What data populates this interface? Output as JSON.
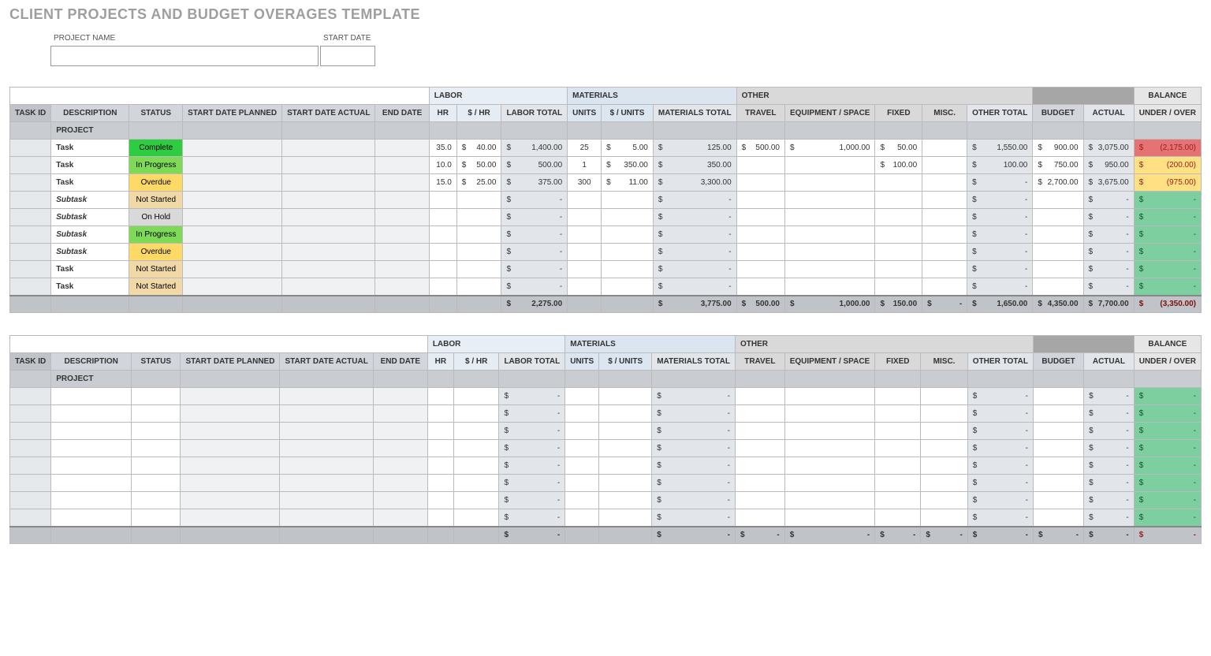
{
  "page": {
    "title": "CLIENT PROJECTS AND BUDGET OVERAGES TEMPLATE",
    "fields": {
      "project_name_label": "PROJECT NAME",
      "start_date_label": "START DATE",
      "project_name_value": "",
      "start_date_value": ""
    }
  },
  "sections": {
    "labor": "LABOR",
    "materials": "MATERIALS",
    "other": "OTHER",
    "balance": "BALANCE"
  },
  "columns": {
    "task_id": "TASK ID",
    "description": "DESCRIPTION",
    "status": "STATUS",
    "start_planned": "START DATE PLANNED",
    "start_actual": "START DATE ACTUAL",
    "end_date": "END DATE",
    "hr": "HR",
    "rate": "$ / HR",
    "labor_total": "LABOR TOTAL",
    "units": "UNITS",
    "per_units": "$ / UNITS",
    "materials_total": "MATERIALS TOTAL",
    "travel": "TRAVEL",
    "equipment": "EQUIPMENT / SPACE",
    "fixed": "FIXED",
    "misc": "MISC.",
    "other_total": "OTHER TOTAL",
    "budget": "BUDGET",
    "actual": "ACTUAL",
    "under_over": "UNDER / OVER"
  },
  "status_labels": {
    "complete": "Complete",
    "in_progress": "In Progress",
    "overdue": "Overdue",
    "not_started": "Not Started",
    "on_hold": "On Hold"
  },
  "row_labels": {
    "project": "PROJECT",
    "task": "Task",
    "subtask": "Subtask"
  },
  "block1": {
    "rows": [
      {
        "desc": "Task",
        "status": "complete",
        "hr": "35.0",
        "rate": "40.00",
        "labor_total": "1,400.00",
        "units": "25",
        "per_units": "5.00",
        "materials_total": "125.00",
        "travel": "500.00",
        "equipment": "1,000.00",
        "fixed": "50.00",
        "misc": "",
        "other_total": "1,550.00",
        "budget": "900.00",
        "actual": "3,075.00",
        "balance": "(2,175.00)",
        "bal_class": "bal-neg-hi"
      },
      {
        "desc": "Task",
        "status": "in_progress",
        "hr": "10.0",
        "rate": "50.00",
        "labor_total": "500.00",
        "units": "1",
        "per_units": "350.00",
        "materials_total": "350.00",
        "travel": "",
        "equipment": "",
        "fixed": "100.00",
        "misc": "",
        "other_total": "100.00",
        "budget": "750.00",
        "actual": "950.00",
        "balance": "(200.00)",
        "bal_class": "bal-neg"
      },
      {
        "desc": "Task",
        "status": "overdue",
        "hr": "15.0",
        "rate": "25.00",
        "labor_total": "375.00",
        "units": "300",
        "per_units": "11.00",
        "materials_total": "3,300.00",
        "travel": "",
        "equipment": "",
        "fixed": "",
        "misc": "",
        "other_total": "-",
        "budget": "2,700.00",
        "actual": "3,675.00",
        "balance": "(975.00)",
        "bal_class": "bal-neg"
      },
      {
        "desc": "Subtask",
        "status": "not_started",
        "labor_total": "-",
        "materials_total": "-",
        "other_total": "-",
        "actual": "-",
        "balance": "-",
        "bal_class": "bal-zero"
      },
      {
        "desc": "Subtask",
        "status": "on_hold",
        "labor_total": "-",
        "materials_total": "-",
        "other_total": "-",
        "actual": "-",
        "balance": "-",
        "bal_class": "bal-zero"
      },
      {
        "desc": "Subtask",
        "status": "in_progress",
        "labor_total": "-",
        "materials_total": "-",
        "other_total": "-",
        "actual": "-",
        "balance": "-",
        "bal_class": "bal-zero"
      },
      {
        "desc": "Subtask",
        "status": "overdue",
        "labor_total": "-",
        "materials_total": "-",
        "other_total": "-",
        "actual": "-",
        "balance": "-",
        "bal_class": "bal-zero"
      },
      {
        "desc": "Task",
        "status": "not_started",
        "labor_total": "-",
        "materials_total": "-",
        "other_total": "-",
        "actual": "-",
        "balance": "-",
        "bal_class": "bal-zero"
      },
      {
        "desc": "Task",
        "status": "not_started",
        "labor_total": "-",
        "materials_total": "-",
        "other_total": "-",
        "actual": "-",
        "balance": "-",
        "bal_class": "bal-zero"
      }
    ],
    "totals": {
      "labor_total": "2,275.00",
      "materials_total": "3,775.00",
      "travel": "500.00",
      "equipment": "1,000.00",
      "fixed": "150.00",
      "misc": "-",
      "other_total": "1,650.00",
      "budget": "4,350.00",
      "actual": "7,700.00",
      "balance": "(3,350.00)"
    }
  },
  "block2": {
    "row_count": 8,
    "totals": {
      "labor_total": "-",
      "materials_total": "-",
      "travel": "-",
      "equipment": "-",
      "fixed": "-",
      "misc": "-",
      "other_total": "-",
      "budget": "-",
      "actual": "-",
      "balance": "-"
    }
  }
}
